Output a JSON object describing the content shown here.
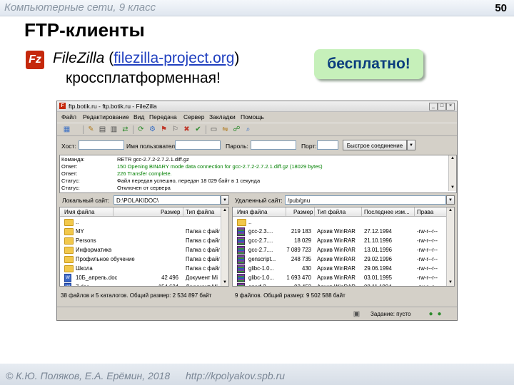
{
  "slide": {
    "course": "Компьютерные сети, 9 класс",
    "page_number": "50",
    "title": "FTP-клиенты",
    "logo_text": "Fz",
    "app_name": "FileZilla",
    "open_paren": "(",
    "link": "filezilla-project.org",
    "close_paren": ")",
    "subtitle": "кроссплатформенная!",
    "badge": "бесплатно!",
    "credit": "© К.Ю. Поляков, Е.А. Ерёмин, 2018",
    "site": "http://kpolyakov.spb.ru"
  },
  "window": {
    "title": "ftp.botik.ru - ftp.botik.ru - FileZilla",
    "controls": [
      "_",
      "□",
      "×"
    ],
    "menu": [
      "Файл",
      "Редактирование",
      "Вид",
      "Передача",
      "Сервер",
      "Закладки",
      "Помощь"
    ],
    "quick": {
      "host_label": "Хост:",
      "user_label": "Имя пользователя",
      "pass_label": "Пароль:",
      "port_label": "Порт:",
      "connect_label": "Быстрое соединение",
      "dropdown_arrow": "▼"
    },
    "log": [
      {
        "label": "Команда:",
        "text": "RETR gcc-2.7.2-2.7.2.1.diff.gz",
        "color": "#000000"
      },
      {
        "label": "Ответ:",
        "text": "150 Opening BINARY mode data connection for gcc-2.7.2-2.7.2.1.diff.gz (18029 bytes)",
        "color": "#008000"
      },
      {
        "label": "Ответ:",
        "text": "226 Transfer complete.",
        "color": "#008000"
      },
      {
        "label": "Статус:",
        "text": "Файл передан успешно, передан 18 029 байт в 1 секунда",
        "color": "#000000"
      },
      {
        "label": "Статус:",
        "text": "Отключен от сервера",
        "color": "#000000"
      }
    ],
    "local": {
      "site_label": "Локальный сайт:",
      "path": "D:\\POLAK\\DOC\\",
      "columns": [
        "Имя файла",
        "Размер",
        "Тип файла"
      ],
      "files": [
        {
          "icon": "folder",
          "name": "..",
          "size": "",
          "type": ""
        },
        {
          "icon": "folder",
          "name": "MY",
          "size": "",
          "type": "Папка с файл"
        },
        {
          "icon": "folder",
          "name": "Persons",
          "size": "",
          "type": "Папка с файл"
        },
        {
          "icon": "folder",
          "name": "Информатика",
          "size": "",
          "type": "Папка с файл"
        },
        {
          "icon": "folder",
          "name": "Профильное обучение",
          "size": "",
          "type": "Папка с файл"
        },
        {
          "icon": "folder",
          "name": "Школа",
          "size": "",
          "type": "Папка с файл"
        },
        {
          "icon": "doc",
          "name": "10Б_апрель.doc",
          "size": "42 496",
          "type": "Документ Mi"
        },
        {
          "icon": "doc",
          "name": "7.doc",
          "size": "154 624",
          "type": "Документ Mi"
        }
      ],
      "status": "38 файлов и 5 каталогов. Общий размер: 2 534 897 байт"
    },
    "remote": {
      "site_label": "Удаленный сайт:",
      "path": "/pub/gnu",
      "columns": [
        "Имя файла",
        "Размер",
        "Тип файла",
        "Последнее изм...",
        "Права"
      ],
      "files": [
        {
          "icon": "folder",
          "name": "..",
          "size": "",
          "type": "",
          "modified": "",
          "perms": ""
        },
        {
          "icon": "rar",
          "name": "gcc-2.3....",
          "size": "219 183",
          "type": "Архив WinRAR",
          "modified": "27.12.1994",
          "perms": "-rw-r--r--"
        },
        {
          "icon": "rar",
          "name": "gcc-2.7....",
          "size": "18 029",
          "type": "Архив WinRAR",
          "modified": "21.10.1996",
          "perms": "-rw-r--r--"
        },
        {
          "icon": "rar",
          "name": "gcc-2.7....",
          "size": "7 089 723",
          "type": "Архив WinRAR",
          "modified": "13.01.1996",
          "perms": "-rw-r--r--"
        },
        {
          "icon": "rar",
          "name": "genscript...",
          "size": "248 735",
          "type": "Архив WinRAR",
          "modified": "29.02.1996",
          "perms": "-rw-r--r--"
        },
        {
          "icon": "rar",
          "name": "glibc-1.0...",
          "size": "430",
          "type": "Архив WinRAR",
          "modified": "29.06.1994",
          "perms": "-rw-r--r--"
        },
        {
          "icon": "rar",
          "name": "glibc-1.0...",
          "size": "1 693 470",
          "type": "Архив WinRAR",
          "modified": "03.01.1995",
          "perms": "-rw-r--r--"
        },
        {
          "icon": "rar",
          "name": "gperf-2....",
          "size": "92 452",
          "type": "Архив WinRAR",
          "modified": "08.11.1994",
          "perms": "-rw-r--r--"
        }
      ],
      "status": "9 файлов. Общий размер: 9 502 588 байт"
    },
    "queue": {
      "tasks": "Задание: пусто"
    }
  },
  "colors": {
    "accent_link": "#1f3fbf",
    "badge_bg": "#c6f0ba",
    "badge_text": "#0a3d7e",
    "log_ok": "#008000"
  }
}
